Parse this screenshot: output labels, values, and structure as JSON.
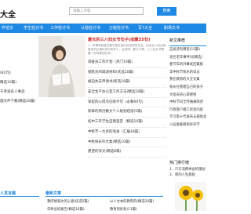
{
  "header": {
    "logo": "大全",
    "search_placeholder": "请输入内容",
    "search_button": "搜索"
  },
  "nav": [
    "作范文",
    "学生检讨书",
    "工作检讨书",
    "认错检讨书",
    "万能检讨书",
    "写7大全",
    "职场文书"
  ],
  "left_list": [
    "(82句)",
    "精选10篇)",
    "于孝道名人事迹",
    "理文件下载(精选18篇)"
  ],
  "featured": {
    "title": "最长的三八妇女节句子(收藏35句)",
    "desc": "1、苹果和西蓝花都不是女孩们该怎样的生活，但说女人向往就爱你的正确你说不如年十，女孩呀，要么子嘛。三八妇女节需要一份特殊的礼物…",
    "items": [
      "调查员工作计划（热门10篇）",
      "销售员的辞退材料(优选10篇)",
      "被迫失去申请书(新选18篇)",
      "安全生产办公室工作方法(精选18篇)",
      "早起的心得点已呢今可（必看60句）",
      "新鲜的原创散文个人规划结语(5篇)",
      "初中三年学生自我鉴定（精选10篇）",
      "中秋节一大早的语录（汇编18篇）",
      "中秋快乐作文集(精选10篇)",
      "愿望的作文(精选8篇)"
    ]
  },
  "right_col": {
    "head": "新文推荐",
    "items": [
      "这说话有哪里(15篇)",
      "谈名老年事件问(精选)",
      "春节年的开幕式后集报",
      "华中秋节快乐的日志",
      "我在教育的大全文集",
      "家长在管理自己的孩子",
      "大雨天的心得感悟",
      "中秋节日全时通通简述",
      "行政客户端工资金内容",
      "学习第十代发布与规划总",
      "入园准备和指导开学"
    ]
  },
  "bottom": {
    "left_head": "人发言稿",
    "mid_head": "最新文章",
    "mid_items": [
      "我所想表达的心意(优选5篇)",
      "年终总结报告(精选10篇)"
    ],
    "right_items": [
      "以人文本的教育的(精选10篇)",
      "教育的好处(11篇)"
    ]
  },
  "hot": {
    "head": "热门排行榜",
    "items": [
      "1、汽车消费季会的策划",
      "2、新的人生旅程"
    ]
  }
}
